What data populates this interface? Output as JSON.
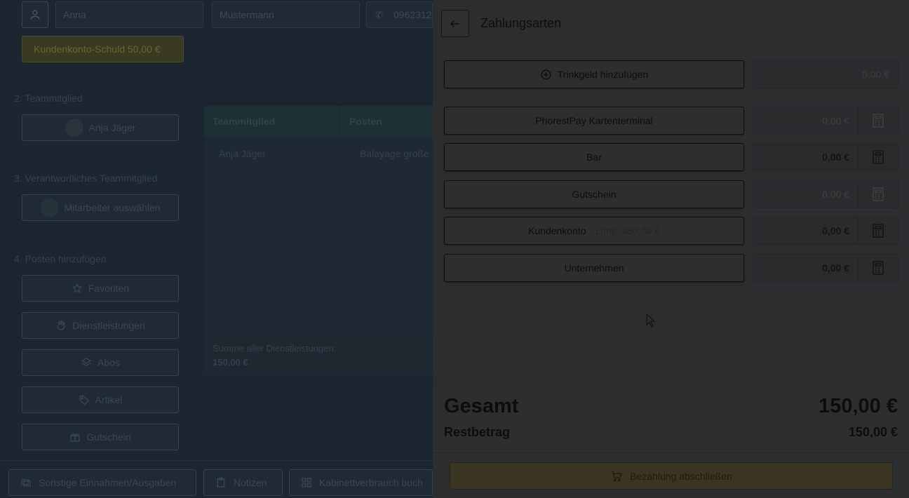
{
  "background": {
    "customer": {
      "first_name": "Anna",
      "last_name": "Mustermann",
      "phone": "0962312",
      "debt_badge": "Kundenkonto-Schuld 50,00 €"
    },
    "sections": {
      "team_member_heading": "2. Teammitglied",
      "team_member_button": "Anja Jäger",
      "responsible_heading": "3. Verantwortliches Teammitglied",
      "responsible_button": "Mitarbeiter auswählen",
      "add_items_heading": "4. Posten hinzufügen"
    },
    "add_items": [
      {
        "label": "Favoriten",
        "icon": "star-icon"
      },
      {
        "label": "Dienstleistungen",
        "icon": "hand-icon"
      },
      {
        "label": "Abos",
        "icon": "layers-icon"
      },
      {
        "label": "Artikel",
        "icon": "tag-icon"
      },
      {
        "label": "Gutschein",
        "icon": "gift-icon"
      }
    ],
    "table": {
      "headers": [
        "Teammitglied",
        "Posten"
      ],
      "row": [
        "Anja Jäger",
        "Balayage große"
      ],
      "sum_label": "Summe aller Dienstleistungen:",
      "sum_value": "150,00 €"
    },
    "bottom_bar": [
      {
        "label": "Sonstige Einnahmen/Ausgaben",
        "icon": "cash-icon"
      },
      {
        "label": "Notizen",
        "icon": "clipboard-icon"
      },
      {
        "label": "Kabinettverbrauch buch",
        "icon": "grid-icon"
      }
    ]
  },
  "panel": {
    "title": "Zahlungsarten",
    "tip": {
      "label": "Trinkgeld hinzufügen",
      "amount": "0,00 €"
    },
    "methods": [
      {
        "label": "PhorestPay Kartenterminal",
        "amount": "0,00 €",
        "disabled": true
      },
      {
        "label": "Bar",
        "amount": "0,00 €",
        "disabled": false
      },
      {
        "label": "Gutschein",
        "amount": "0,00 €",
        "disabled": true
      },
      {
        "label": "Kundenkonto",
        "limit": "- Limit: 450,00 €",
        "amount": "0,00 €",
        "disabled": false
      },
      {
        "label": "Unternehmen",
        "amount": "0,00 €",
        "disabled": false
      }
    ],
    "total_label": "Gesamt",
    "total_value": "150,00 €",
    "rest_label": "Restbetrag",
    "rest_value": "150,00 €",
    "finish_label": "Bezahlung abschließen"
  }
}
